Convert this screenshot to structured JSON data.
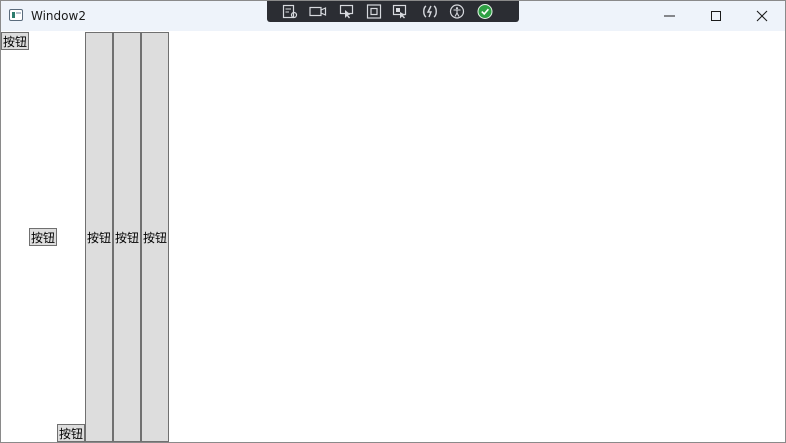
{
  "window": {
    "title": "Window2",
    "app_icon": "window-app-icon"
  },
  "debug_toolbar": {
    "icons": [
      "select-element-icon",
      "video-icon",
      "pointer-select-icon",
      "layout-adorner-icon",
      "track-focus-icon",
      "hot-reload-icon",
      "accessibility-icon",
      "check-circle-icon"
    ],
    "accent_check": "#2ea043"
  },
  "caption_buttons": {
    "minimize": "minimize-icon",
    "maximize": "maximize-icon",
    "close": "close-icon"
  },
  "buttons": {
    "top_left": "按钮",
    "middle_left": "按钮",
    "bottom_left": "按钮",
    "column_1": "按钮",
    "column_2": "按钮",
    "column_3": "按钮"
  },
  "colors": {
    "titlebar": "#eef3fa",
    "button_bg": "#dddddd",
    "button_border": "#707070",
    "toolbar_bg": "#2b2d33"
  }
}
